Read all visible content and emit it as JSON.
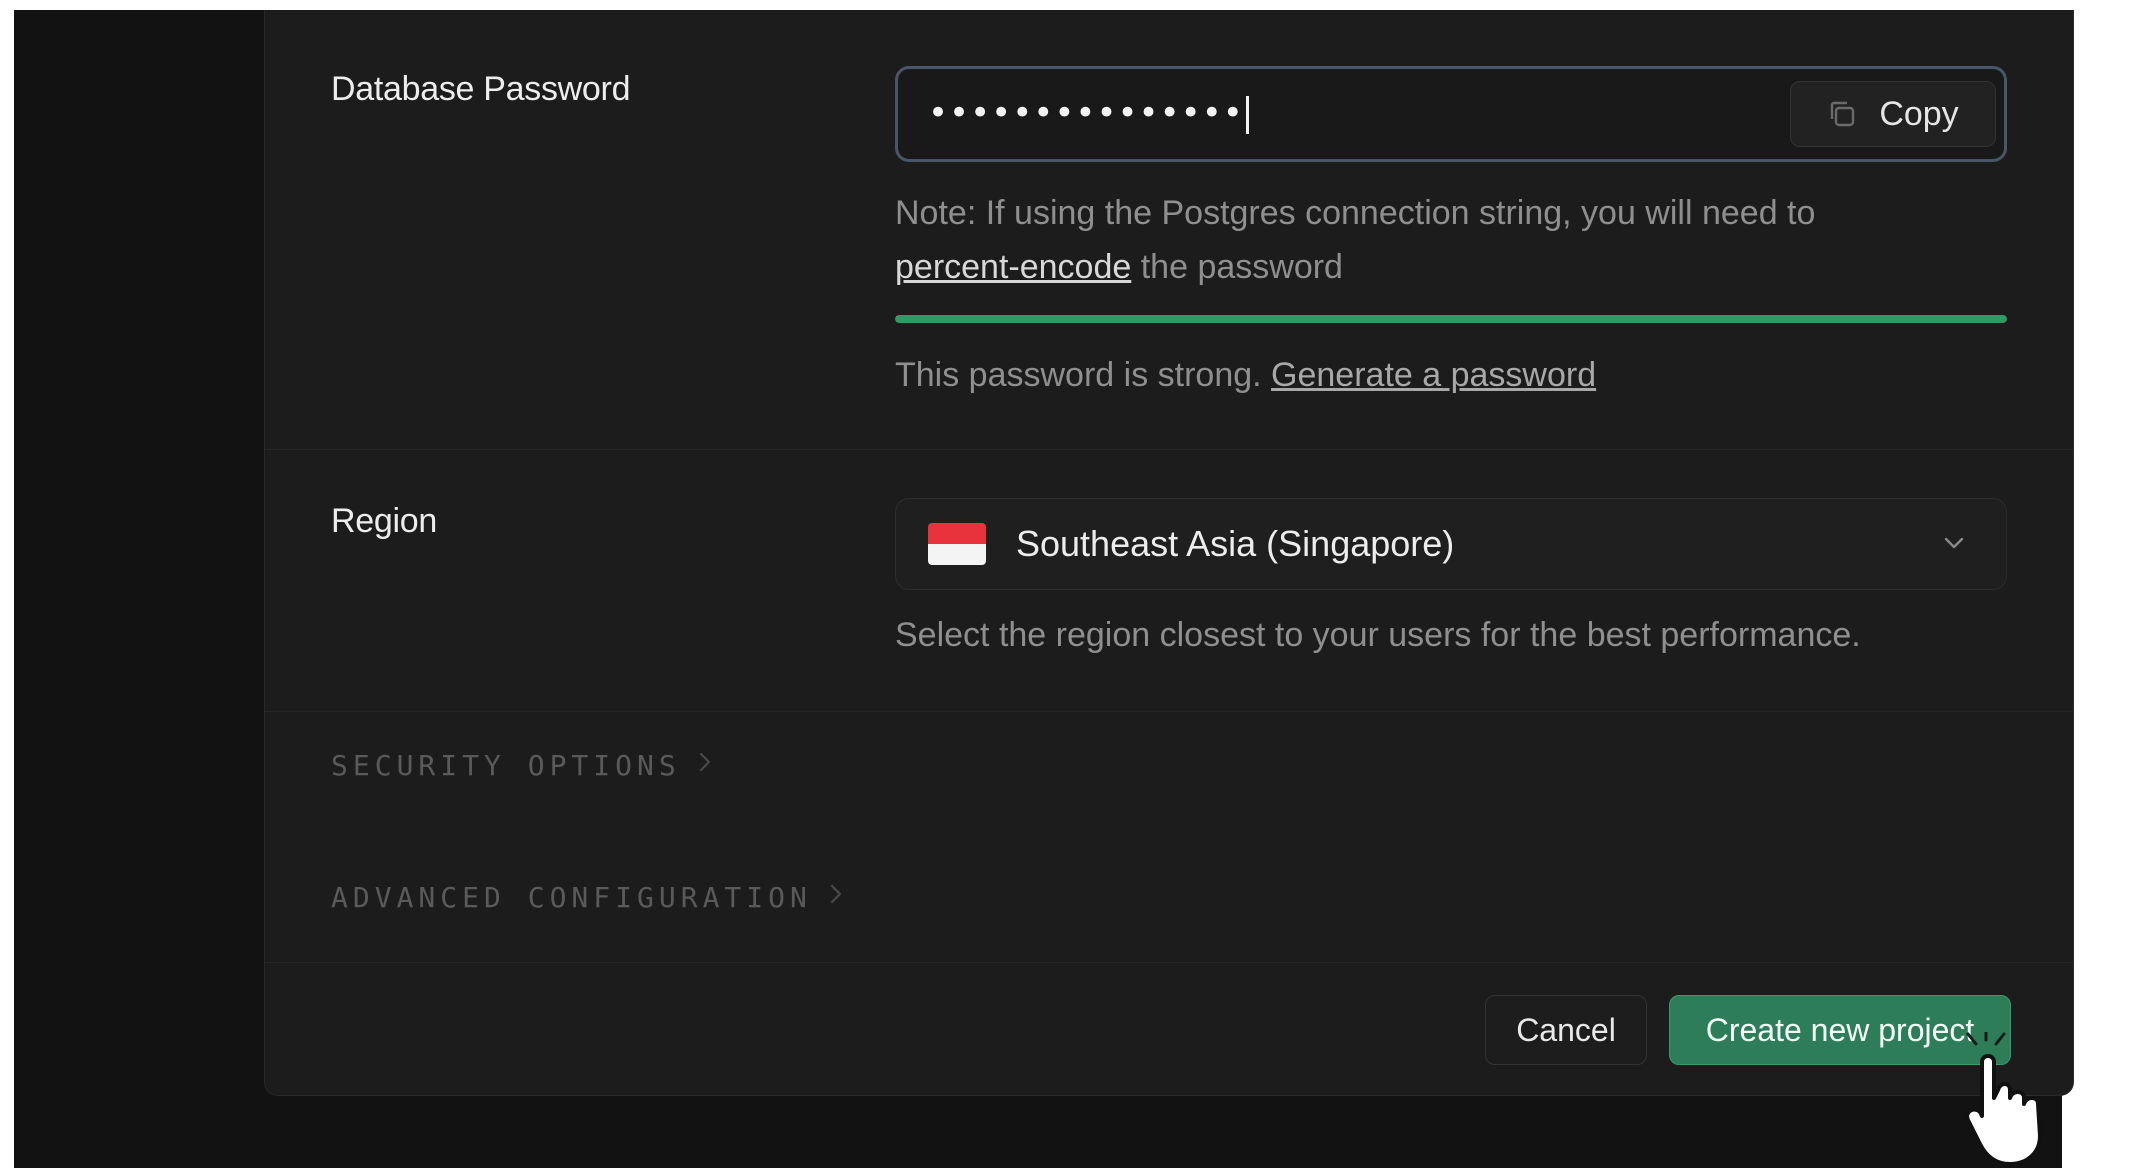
{
  "password_section": {
    "label": "Database Password",
    "masked_value": "•••••••••••••••",
    "copy_label": "Copy",
    "note_prefix": "Note: If using the Postgres connection string, you will need to",
    "note_link": "percent-encode",
    "note_suffix": "the password",
    "strength_fraction": 1.0,
    "strength_color": "#2f9a63",
    "strength_text": "This password is strong.",
    "generate_link": "Generate a password"
  },
  "region_section": {
    "label": "Region",
    "selected": "Southeast Asia (Singapore)",
    "flag_icon": "singapore-flag-icon",
    "help": "Select the region closest to your users for the best performance."
  },
  "collapsibles": {
    "security": "SECURITY OPTIONS",
    "advanced": "ADVANCED CONFIGURATION"
  },
  "footer": {
    "cancel_label": "Cancel",
    "create_label": "Create new project"
  },
  "colors": {
    "background": "#121212",
    "panel": "#1c1c1c",
    "accent_green": "#2e7d59",
    "input_focus_border": "#48566a"
  }
}
